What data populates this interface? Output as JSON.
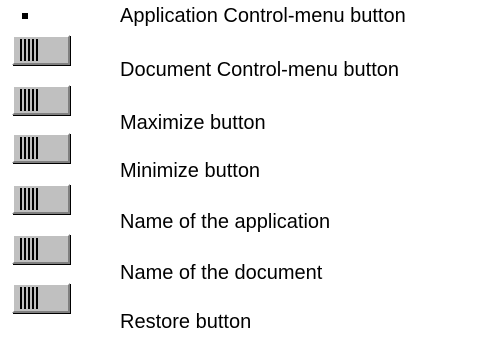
{
  "partial_top_text": "Application Control-menu button",
  "items": [
    {
      "label": "Application Control-menu button",
      "icon": "bullet"
    },
    {
      "label": "Document Control-menu button",
      "icon": "hotspot-button"
    },
    {
      "label": "Maximize button",
      "icon": "hotspot-button"
    },
    {
      "label": "Minimize button",
      "icon": "hotspot-button"
    },
    {
      "label": "Name of the application",
      "icon": "hotspot-button"
    },
    {
      "label": "Name of the document",
      "icon": "hotspot-button"
    },
    {
      "label": "Restore button",
      "icon": "hotspot-button"
    }
  ]
}
